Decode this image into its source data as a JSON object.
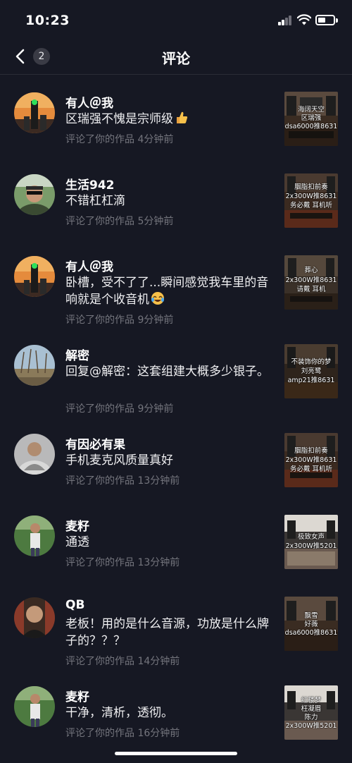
{
  "status_bar": {
    "time": "10:23"
  },
  "nav": {
    "badge_count": "2",
    "title": "评论"
  },
  "items": [
    {
      "name": "有人＠我",
      "comment": "区瑞强不愧是宗师级",
      "emoji": "thumbs-up",
      "meta": "评论了你的作品  4分钟前",
      "thumb_lines": [
        "海阔天空",
        "区瑞强",
        "dsa6000推8631"
      ]
    },
    {
      "name": "生活942",
      "comment": "不错杠杠滴",
      "meta": "评论了你的作品  5分钟前",
      "thumb_lines": [
        "胭脂扣前奏",
        "2x300W推8631",
        "务必戴  耳机听"
      ]
    },
    {
      "name": "有人＠我",
      "comment": "卧槽，受不了了...瞬间感觉我车里的音响就是个收音机",
      "emoji": "laughing-crying",
      "meta": "评论了你的作品  9分钟前",
      "thumb_lines": [
        "葬心",
        "2x300W推8631",
        "请戴  耳机"
      ]
    },
    {
      "name": "解密",
      "comment": "回复@解密：这套组建大概多少银子。",
      "meta": "评论了你的作品  9分钟前",
      "thumb_lines": [
        "不装饰你的梦",
        "刘亮鹭",
        "amp21推8631"
      ]
    },
    {
      "name": "有因必有果",
      "comment": "手机麦克风质量真好",
      "meta": "评论了你的作品  13分钟前",
      "thumb_lines": [
        "胭脂扣前奏",
        "2x300W推8631",
        "务必戴  耳机听"
      ]
    },
    {
      "name": "麦籽",
      "comment": "通透",
      "meta": "评论了你的作品  13分钟前",
      "thumb_lines": [
        "极致女声",
        "2x300W推5201"
      ]
    },
    {
      "name": "QB",
      "comment": "老板！用的是什么音源，功放是什么牌子的？？？",
      "meta": "评论了你的作品  14分钟前",
      "thumb_lines": [
        "飘雪",
        "好薇",
        "dsa6000推8631"
      ]
    },
    {
      "name": "麦籽",
      "comment": "干净，清析，透彻。",
      "meta": "评论了你的作品  16分钟前",
      "thumb_lines": [
        "红楼梦",
        "枉凝眉",
        "陈力",
        "2x300W推5201"
      ]
    }
  ]
}
